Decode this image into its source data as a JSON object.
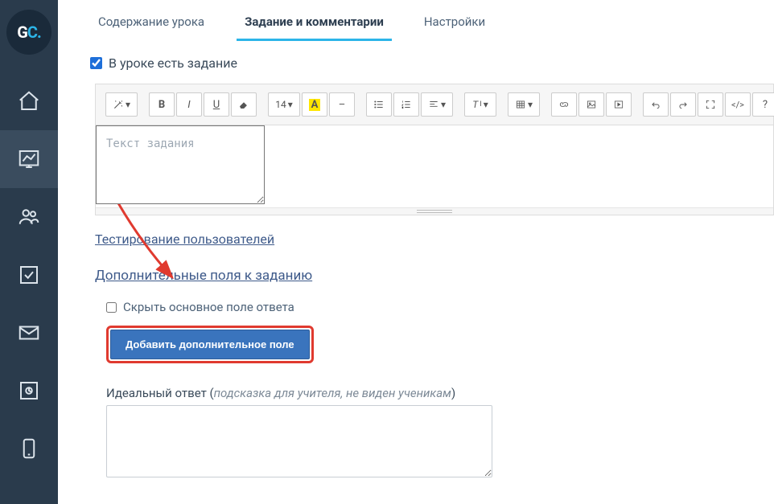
{
  "logo": {
    "g": "G",
    "c": "C",
    "dot": "."
  },
  "tabs": {
    "content": "Содержание урока",
    "task": "Задание и комментарии",
    "settings": "Настройки"
  },
  "has_task_label": "В уроке есть задание",
  "editor": {
    "placeholder": "Текст задания",
    "fontsize": "14"
  },
  "testing_link": "Тестирование пользователей",
  "extra_fields_link": "Дополнительные поля к заданию",
  "hide_main_label": "Скрыть основное поле ответа",
  "add_extra_button": "Добавить дополнительное поле",
  "ideal": {
    "label": "Идеальный ответ (",
    "hint": "подсказка для учителя, не виден ученикам",
    "close": ")"
  },
  "toolbar_chars": {
    "bold": "B",
    "italic": "I",
    "underline": "U",
    "highlight": "A",
    "textstyle": "T",
    "question": "?",
    "code": "</>",
    "caret": "▾",
    "dash": "–"
  }
}
